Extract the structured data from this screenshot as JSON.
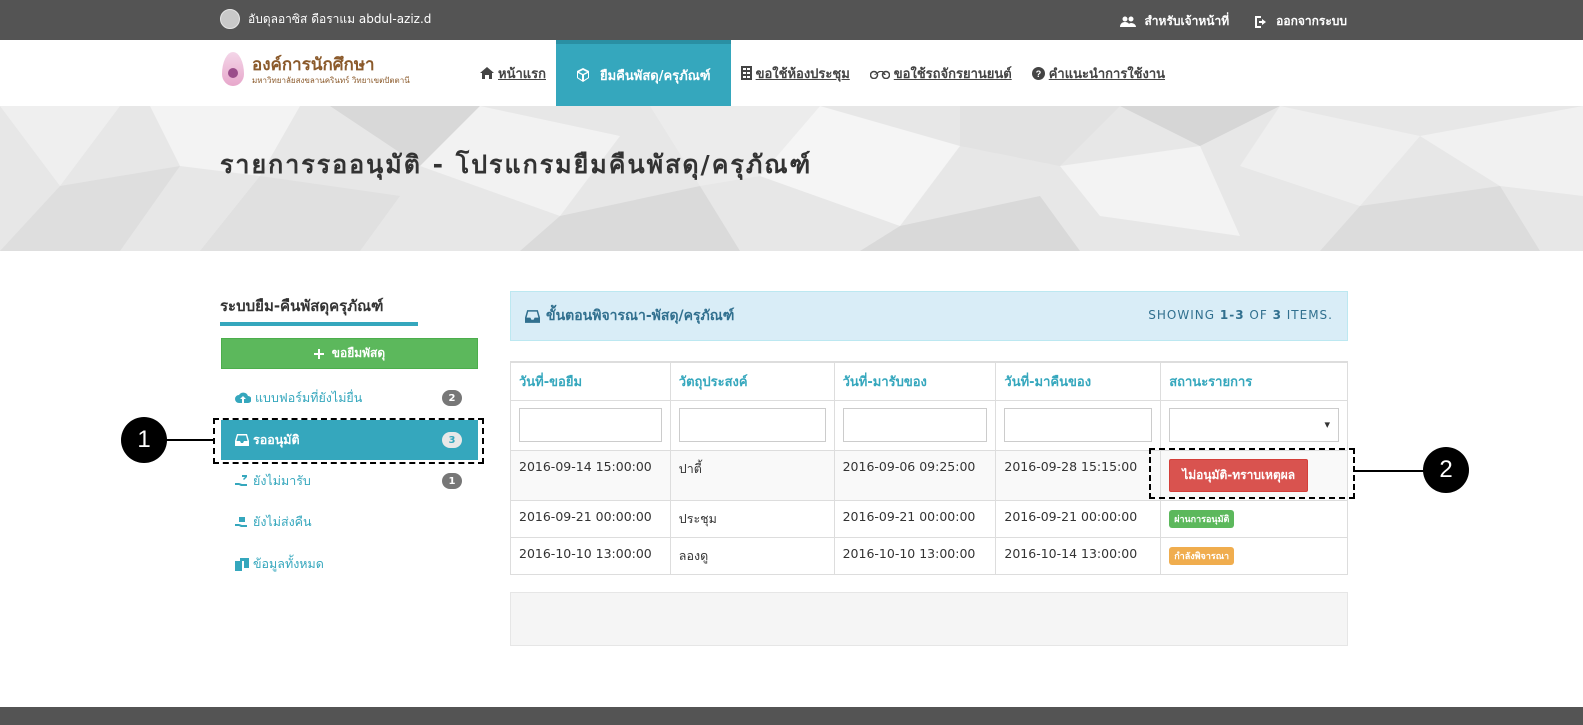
{
  "topbar": {
    "user_name": "อับดุลอาซิส ดือราแม abdul-aziz.d",
    "staff_label": "สำหรับเจ้าหน้าที่",
    "logout_label": "ออกจากระบบ"
  },
  "logo": {
    "title": "องค์การนักศึกษา",
    "subtitle": "มหาวิทยาลัยสงขลานครินทร์ วิทยาเขตปัตตานี"
  },
  "menu": {
    "home": "หน้าแรก",
    "borrow": "ยืมคืนพัสดุ/ครุภัณฑ์",
    "meeting": "ขอใช้ห้องประชุม",
    "vehicle": "ขอใช้รถจักรยานยนต์",
    "help": "คำแนะนำการใช้งาน"
  },
  "hero": {
    "title": "รายการรออนุมัติ - โปรแกรมยืมคืนพัสดุ/ครุภัณฑ์"
  },
  "sidebar": {
    "title": "ระบบยืม-คืนพัสดุครุภัณฑ์",
    "add_label": "ขอยืมพัสดุ",
    "items": [
      {
        "label": "แบบฟอร์มที่ยังไม่ยื่น",
        "badge": "2"
      },
      {
        "label": "รออนุมัติ",
        "badge": "3"
      },
      {
        "label": "ยังไม่มารับ",
        "badge": "1"
      },
      {
        "label": "ยังไม่ส่งคืน",
        "badge": ""
      },
      {
        "label": "ข้อมูลทั้งหมด",
        "badge": ""
      }
    ]
  },
  "callouts": {
    "one": "1",
    "two": "2"
  },
  "panel": {
    "title": "ขั้นตอนพิจารณา-พัสดุ/ครุภัณฑ์",
    "summary_prefix": "SHOWING",
    "summary_range": "1-3",
    "summary_of": "OF",
    "summary_total": "3",
    "summary_suffix": "ITEMS."
  },
  "table": {
    "headers": [
      "วันที่-ขอยืม",
      "วัตถุประสงค์",
      "วันที่-มารับของ",
      "วันที่-มาคืนของ",
      "สถานะรายการ"
    ],
    "rows": [
      {
        "borrow_date": "2016-09-14 15:00:00",
        "purpose": "ปาตี้",
        "pickup_date": "2016-09-06 09:25:00",
        "return_date": "2016-09-28 15:15:00",
        "status": "ไม่อนุมัติ-ทราบเหตุผล"
      },
      {
        "borrow_date": "2016-09-21 00:00:00",
        "purpose": "ประชุม",
        "pickup_date": "2016-09-21 00:00:00",
        "return_date": "2016-09-21 00:00:00",
        "status": "ผ่านการอนุมัติ"
      },
      {
        "borrow_date": "2016-10-10 13:00:00",
        "purpose": "ลองดู",
        "pickup_date": "2016-10-10 13:00:00",
        "return_date": "2016-10-14 13:00:00",
        "status": "กำลังพิจารณา"
      }
    ]
  },
  "colors": {
    "accent": "#35a7bd",
    "success": "#5cb85c",
    "danger": "#d9534f",
    "warning": "#f0ad4e",
    "topbar": "#545454"
  }
}
